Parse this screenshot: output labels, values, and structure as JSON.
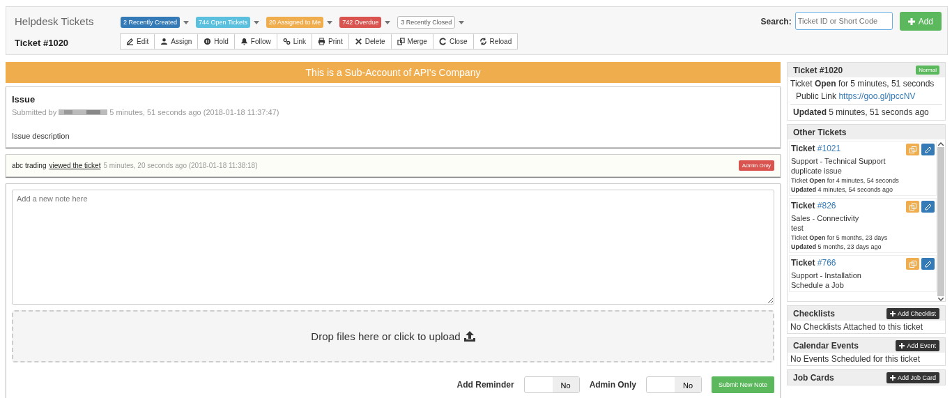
{
  "header": {
    "title": "Helpdesk Tickets",
    "ticket": "Ticket #1020",
    "filters": [
      {
        "label": "2 Recently Created",
        "color": "#337ab7"
      },
      {
        "label": "744 Open Tickets",
        "color": "#5bc0de"
      },
      {
        "label": "20 Assigned to Me",
        "color": "#f0ad4e"
      },
      {
        "label": "742 Overdue",
        "color": "#d9534f"
      },
      {
        "label": "3 Recently Closed",
        "color": "#ffffff"
      }
    ],
    "actions": [
      "Edit",
      "Assign",
      "Hold",
      "Follow",
      "Link",
      "Print",
      "Delete",
      "Merge",
      "Close",
      "Reload"
    ],
    "search_label": "Search:",
    "search_placeholder": "Ticket ID or Short Code",
    "add_button": "Add"
  },
  "banner": "This is a Sub-Account of API's Company",
  "issue": {
    "title": "Issue",
    "submitted_by": "Submitted by",
    "submitted_time": "5 minutes, 51 seconds ago (2018-01-18 11:37:47)",
    "description": "Issue description"
  },
  "activity": {
    "actor": "abc trading",
    "action": "viewed the ticket",
    "time": "5 minutes, 20 seconds ago (2018-01-18 11:38:18)",
    "badge": "Admin Only"
  },
  "note": {
    "placeholder": "Add a new note here",
    "upload": "Drop files here or click to upload",
    "toggles": [
      {
        "label": "Add Reminder",
        "value": "No",
        "on": false
      },
      {
        "label": "Admin Only",
        "value": "No",
        "on": false
      }
    ],
    "submit": "Submit New Note"
  },
  "summary": {
    "title": "Ticket #1020",
    "priority": "Normal",
    "status_prefix": "Ticket",
    "status": "Open",
    "status_suffix": "for 5 minutes, 51 seconds",
    "link_label": "Public Link",
    "link": "https://goo.gl/jpccNV",
    "updated_label": "Updated",
    "updated": "5 minutes, 51 seconds ago"
  },
  "other_tickets": {
    "title": "Other Tickets",
    "items": [
      {
        "label": "Ticket",
        "number": "#1021",
        "category": "Support - Technical Support",
        "subject": "duplicate issue",
        "open_label": "Ticket",
        "status": "Open",
        "open_for": "for 4 minutes, 54 seconds",
        "updated_label": "Updated",
        "updated": "4 minutes, 54 seconds ago"
      },
      {
        "label": "Ticket",
        "number": "#826",
        "category": "Sales - Connectivity",
        "subject": "test",
        "open_label": "Ticket",
        "status": "Open",
        "open_for": "for 5 months, 23 days",
        "updated_label": "Updated",
        "updated": "5 months, 23 days ago"
      },
      {
        "label": "Ticket",
        "number": "#766",
        "category": "Support - Installation",
        "subject": "Schedule a Job"
      }
    ]
  },
  "panels": [
    {
      "title": "Checklists",
      "button": "Add Checklist",
      "body": "No Checklists Attached to this ticket"
    },
    {
      "title": "Calendar Events",
      "button": "Add Event",
      "body": "No Events Scheduled for this ticket"
    },
    {
      "title": "Job Cards",
      "button": "Add Job Card"
    }
  ]
}
